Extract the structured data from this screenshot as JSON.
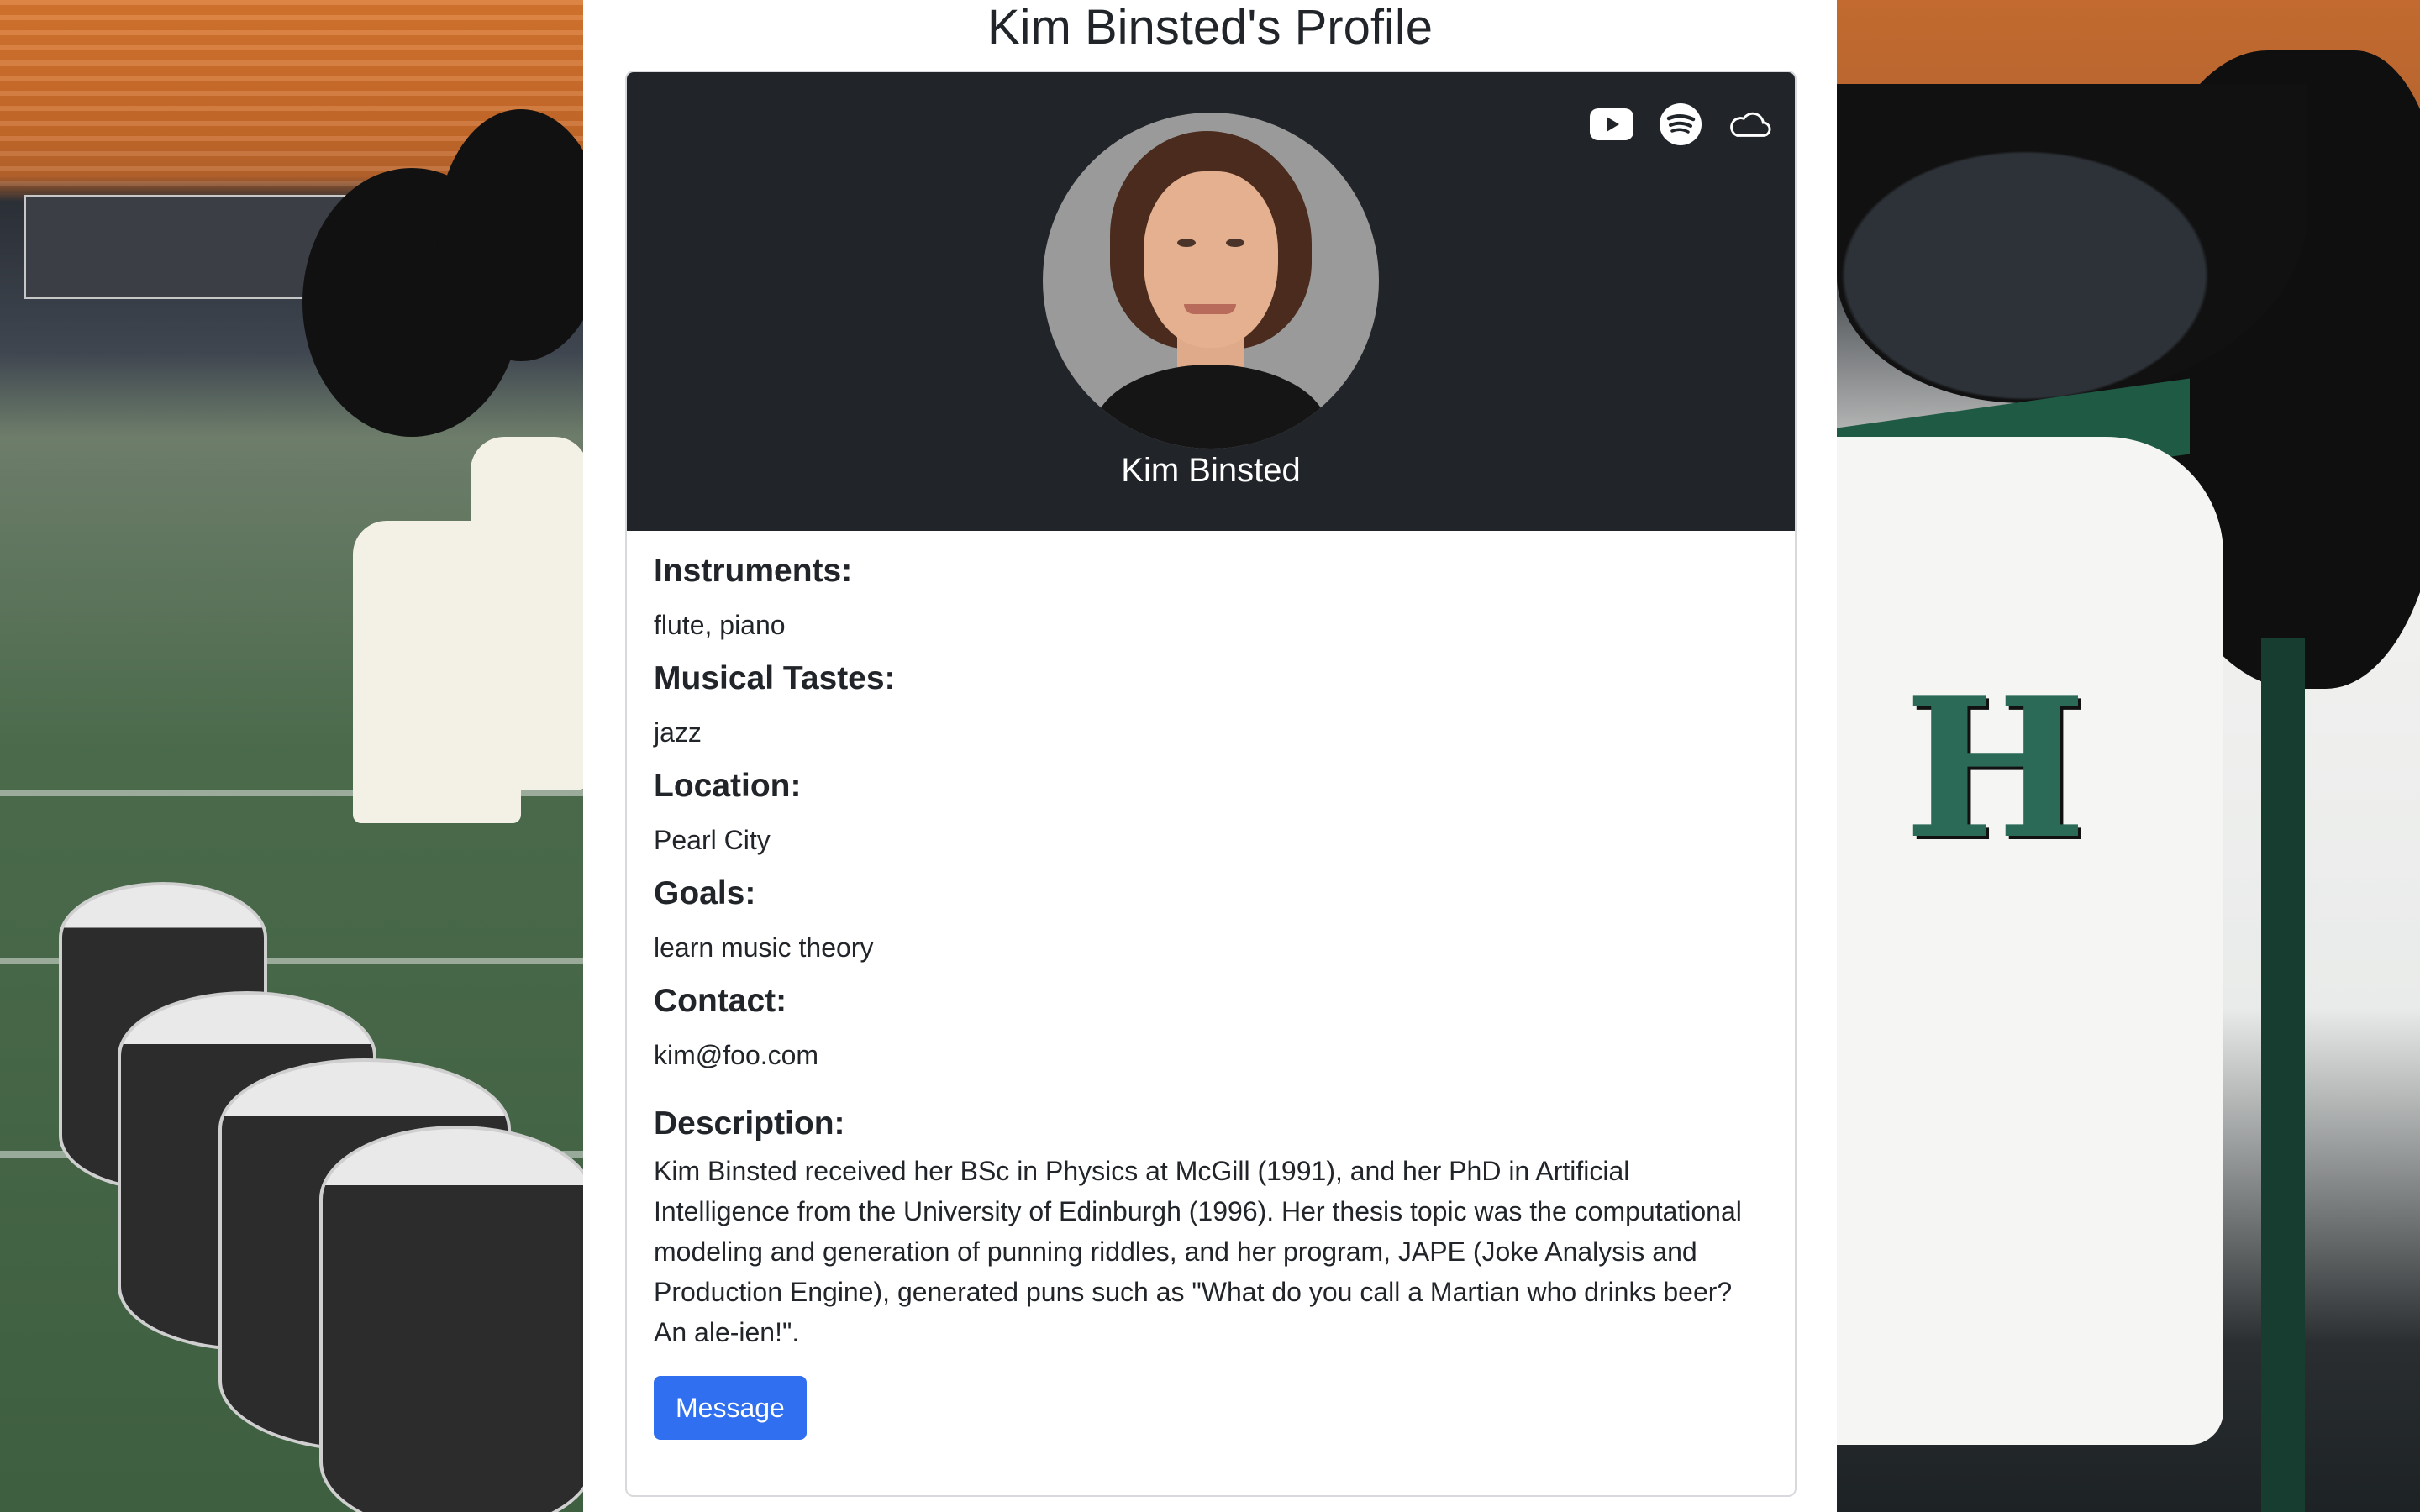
{
  "page": {
    "title": "Kim Binsted's Profile"
  },
  "profile": {
    "name": "Kim Binsted",
    "social_icons": [
      "youtube-icon",
      "spotify-icon",
      "soundcloud-icon"
    ],
    "fields": [
      {
        "label": "Instruments:",
        "value": "flute, piano"
      },
      {
        "label": "Musical Tastes:",
        "value": "jazz"
      },
      {
        "label": "Location:",
        "value": "Pearl City"
      },
      {
        "label": "Goals:",
        "value": "learn music theory"
      },
      {
        "label": "Contact:",
        "value": "kim@foo.com"
      }
    ],
    "description_label": "Description:",
    "description": "Kim Binsted received her BSc in Physics at McGill (1991), and her PhD in Artificial Intelligence from the University of Edinburgh (1996). Her thesis topic was the computational modeling and generation of punning riddles, and her program, JAPE (Joke Analysis and Production Engine), generated puns such as \"What do you call a Martian who drinks beer? An ale-ien!\".",
    "message_button": "Message"
  },
  "colors": {
    "header_bg": "#212529",
    "button_bg": "#2f6ff0",
    "text": "#212529"
  }
}
